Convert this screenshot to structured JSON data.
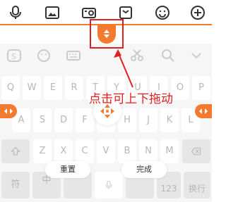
{
  "colors": {
    "accent": "#f47a30",
    "annotation": "#e02020"
  },
  "toolbar": {
    "icons": [
      "microphone-icon",
      "image-icon",
      "camera-icon",
      "gift-box-icon",
      "emoji-icon",
      "plus-icon"
    ]
  },
  "keyboard": {
    "row1": [
      "Q",
      "W",
      "E",
      "R",
      "T",
      "Y",
      "U",
      "I",
      "O",
      "P"
    ],
    "row2": [
      "A",
      "S",
      "D",
      "F",
      "G",
      "H",
      "J",
      "K",
      "L"
    ],
    "row3": [
      "Z",
      "X",
      "C",
      "V",
      "B",
      "N",
      "M"
    ],
    "bottom": {
      "symbol_key": "符",
      "lang_key": "中",
      "number_key": "123",
      "enter_key": "换行"
    }
  },
  "annotation": {
    "text": "点击可上下拖动"
  },
  "buttons": {
    "reset": "重置",
    "done": "完成"
  }
}
